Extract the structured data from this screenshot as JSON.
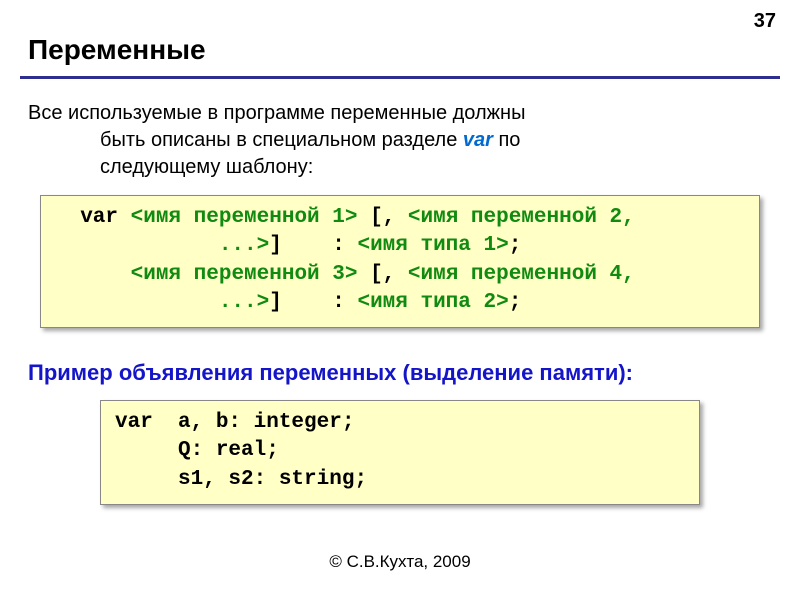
{
  "page_number": "37",
  "title": "Переменные",
  "intro": {
    "line1": "Все используемые в программе переменные должны",
    "line2_a": "быть описаны в специальном разделе ",
    "var_kw": "var",
    "line2_b": " по",
    "line3": "следующему шаблону:"
  },
  "template_code": {
    "l1_a": "  var ",
    "l1_b": "<имя переменной 1>",
    "l1_c": " [, ",
    "l1_d": "<имя переменной 2,",
    "l2_a": "             ...>",
    "l2_b": "]    : ",
    "l2_c": "<имя типа 1>",
    "l2_d": ";",
    "l3_a": "      ",
    "l3_b": "<имя переменной 3>",
    "l3_c": " [, ",
    "l3_d": "<имя переменной 4,",
    "l4_a": "             ...>",
    "l4_b": "]    : ",
    "l4_c": "<имя типа 2>",
    "l4_d": ";"
  },
  "section_label": "Пример объявления переменных (выделение памяти):",
  "example_code": {
    "l1": "var  a, b: integer;",
    "l2": "     Q: real;",
    "l3": "     s1, s2: string;"
  },
  "footer": "© С.В.Кухта, 2009"
}
